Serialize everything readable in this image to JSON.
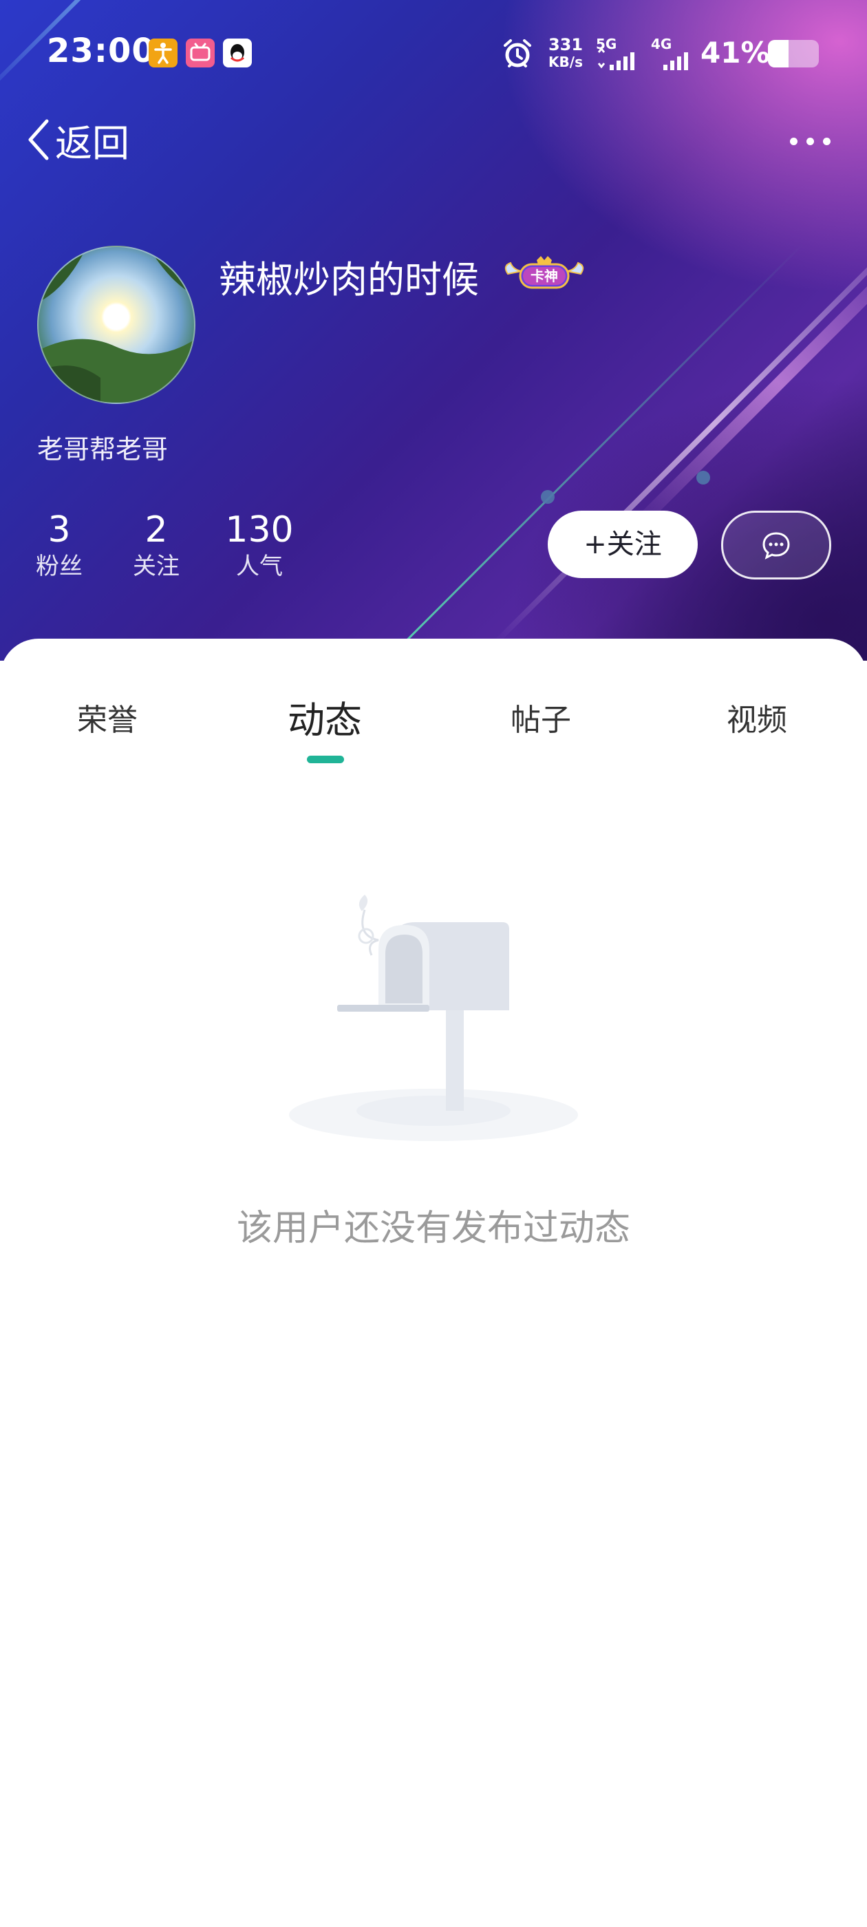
{
  "status_bar": {
    "time": "23:00",
    "net_speed_value": "331",
    "net_speed_unit": "KB/s",
    "sim1_label": "5G",
    "sim2_label": "4G",
    "battery_percent": "41%",
    "battery_level": 0.41
  },
  "nav": {
    "back_label": "返回"
  },
  "profile": {
    "username": "辣椒炒肉的时候",
    "badge_text": "卡神",
    "subtitle": "老哥帮老哥",
    "stats": [
      {
        "value": "3",
        "label": "粉丝"
      },
      {
        "value": "2",
        "label": "关注"
      },
      {
        "value": "130",
        "label": "人气"
      }
    ],
    "follow_label": "+关注"
  },
  "tabs": [
    {
      "label": "荣誉",
      "active": false
    },
    {
      "label": "动态",
      "active": true
    },
    {
      "label": "帖子",
      "active": false
    },
    {
      "label": "视频",
      "active": false
    }
  ],
  "empty_state": {
    "message": "该用户还没有发布过动态"
  },
  "colors": {
    "accent": "#20b497",
    "header_start": "#2c39c9",
    "header_end": "#2a1560"
  }
}
